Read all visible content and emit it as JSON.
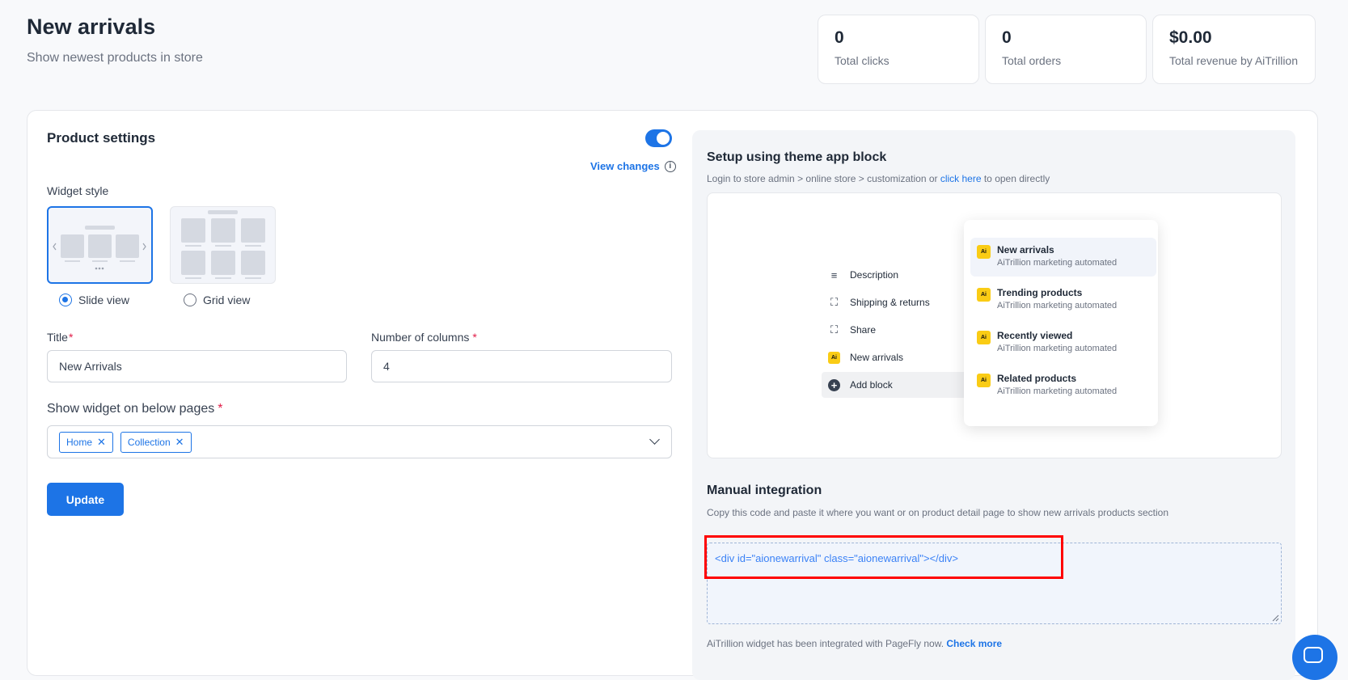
{
  "header": {
    "title": "New arrivals",
    "subtitle": "Show newest products in store"
  },
  "stats": [
    {
      "value": "0",
      "label": "Total clicks"
    },
    {
      "value": "0",
      "label": "Total orders"
    },
    {
      "value": "$0.00",
      "label": "Total revenue by AiTrillion"
    }
  ],
  "settings": {
    "title": "Product settings",
    "enabled": true,
    "view_changes": "View changes",
    "widget_style_label": "Widget style",
    "slide_label": "Slide view",
    "grid_label": "Grid view",
    "selected_style": "Slide view",
    "title_label": "Title",
    "title_value": "New Arrivals",
    "columns_label": "Number of columns",
    "columns_value": "4",
    "pages_label": "Show widget on below pages",
    "pages": [
      "Home",
      "Collection"
    ],
    "update_label": "Update"
  },
  "setup": {
    "title": "Setup using theme app block",
    "instruction_prefix": "Login to store admin > online store > customization or ",
    "instruction_link": "click here",
    "instruction_suffix": " to open directly",
    "blocks": [
      {
        "icon": "lines-icon",
        "label": "Description"
      },
      {
        "icon": "frame-icon",
        "label": "Shipping & returns"
      },
      {
        "icon": "frame-icon",
        "label": "Share"
      },
      {
        "icon": "ai-icon",
        "label": "New arrivals"
      },
      {
        "icon": "plus-icon",
        "label": "Add block"
      }
    ],
    "popover": [
      {
        "title": "New arrivals",
        "sub": "AiTrillion marketing automated"
      },
      {
        "title": "Trending products",
        "sub": "AiTrillion marketing automated"
      },
      {
        "title": "Recently viewed",
        "sub": "AiTrillion marketing automated"
      },
      {
        "title": "Related products",
        "sub": "AiTrillion marketing automated"
      }
    ]
  },
  "manual": {
    "title": "Manual integration",
    "description": "Copy this code and paste it where you want or on product detail page to show new arrivals products section",
    "code": "<div id=\"aionewarrival\" class=\"aionewarrival\"></div>",
    "pagefly_text": "AiTrillion widget has been integrated with PageFly now. ",
    "pagefly_link": "Check more"
  },
  "colors": {
    "accent": "#1d74e6",
    "highlight_border": "#ff0000"
  }
}
